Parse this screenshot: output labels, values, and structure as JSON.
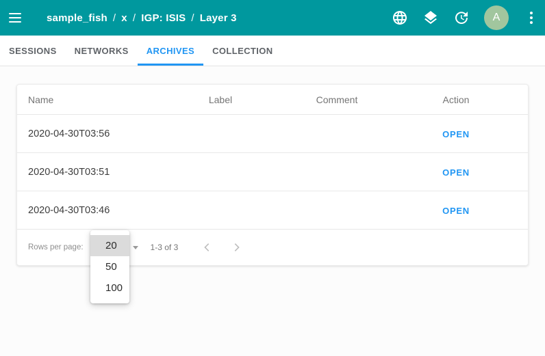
{
  "colors": {
    "appbar_bg": "#00989e",
    "accent_blue": "#2196f3",
    "avatar_bg": "#a1c69e",
    "selected_option_bg": "#dbdbdb"
  },
  "header": {
    "breadcrumb": [
      "sample_fish",
      "x",
      "IGP: ISIS",
      "Layer 3"
    ],
    "separator": "/",
    "avatar_text": "A",
    "icons": [
      "menu-icon",
      "globe-icon",
      "layers-icon",
      "update-icon",
      "avatar",
      "kebab-menu-icon"
    ]
  },
  "tabs": [
    {
      "label": "SESSIONS"
    },
    {
      "label": "NETWORKS"
    },
    {
      "label": "ARCHIVES"
    },
    {
      "label": "COLLECTION"
    }
  ],
  "table": {
    "columns": [
      "Name",
      "Label",
      "Comment",
      "Action"
    ],
    "rows": [
      {
        "name": "2020-04-30T03:56",
        "label": "",
        "comment": "",
        "action": "OPEN"
      },
      {
        "name": "2020-04-30T03:51",
        "label": "",
        "comment": "",
        "action": "OPEN"
      },
      {
        "name": "2020-04-30T03:46",
        "label": "",
        "comment": "",
        "action": "OPEN"
      }
    ]
  },
  "pagination": {
    "rows_per_page_label": "Rows per page:",
    "selected": "20",
    "options": [
      "20",
      "50",
      "100"
    ],
    "range": "1-3 of 3"
  }
}
